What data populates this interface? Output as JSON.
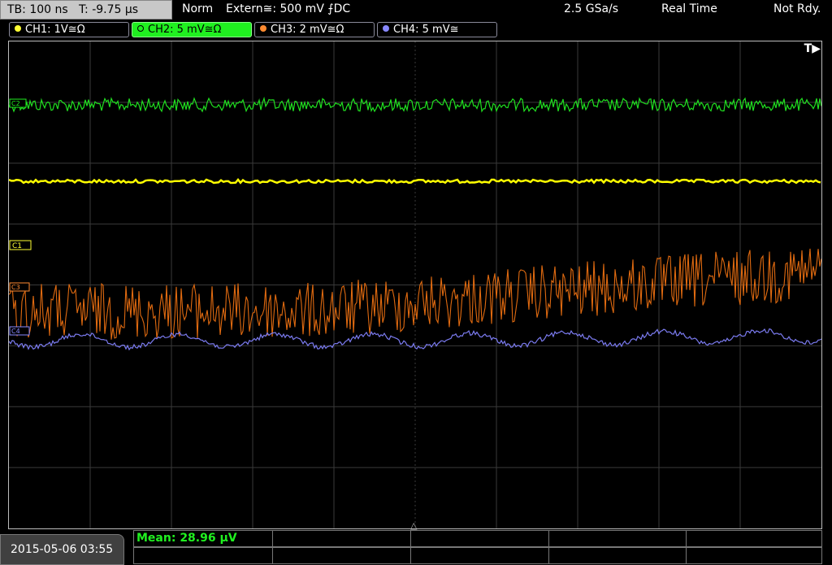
{
  "header": {
    "timebase": "TB: 100 ns",
    "trigger_time": "T: -9.75 µs",
    "mode": "Norm",
    "trigger_source": "Extern≅: 500 mV ⨍DC",
    "sample_rate": "2.5 GSa/s",
    "acq_mode": "Real Time",
    "status": "Not Rdy."
  },
  "channels": [
    {
      "label": "CH1: 1V≅Ω",
      "color": "#ffff33",
      "active": false
    },
    {
      "label": "CH2: 5 mV≅Ω",
      "color": "#20f020",
      "active": true
    },
    {
      "label": "CH3: 2 mV≅Ω",
      "color": "#ff8a30",
      "active": false
    },
    {
      "label": "CH4: 5 mV≅",
      "color": "#8888ff",
      "active": false
    }
  ],
  "screen": {
    "trigger_marker": "T▶",
    "markers": [
      "C1",
      "C2",
      "C3",
      "C4"
    ],
    "trace_colors": {
      "ch1": "#ffff00",
      "ch2": "#20e020",
      "ch3": "#e06a10",
      "ch4": "#7b7bf0"
    }
  },
  "footer": {
    "date": "2015-05-06 03:55",
    "measurement": "Mean: 28.96 µV"
  }
}
